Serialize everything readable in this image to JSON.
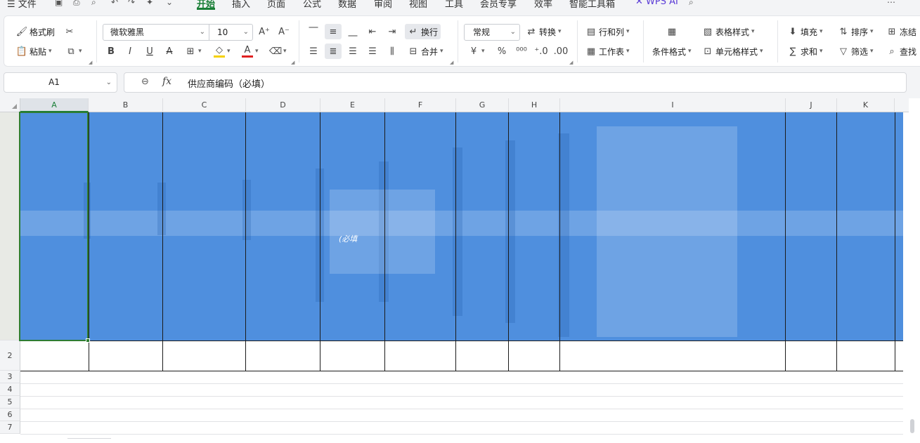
{
  "menu": {
    "file": "文件",
    "tabs": [
      "开始",
      "插入",
      "页面",
      "公式",
      "数据",
      "审阅",
      "视图",
      "工具",
      "会员专享",
      "效率",
      "智能工具箱"
    ],
    "ai": "WPS AI"
  },
  "ribbon": {
    "format_painter": "格式刷",
    "paste": "粘贴",
    "font_name": "微软雅黑",
    "font_size": "10",
    "wrap": "换行",
    "merge": "合并",
    "number_format": "常规",
    "convert": "转换",
    "rows_cols": "行和列",
    "worksheet": "工作表",
    "cond_format": "条件格式",
    "table_style": "表格样式",
    "cell_style": "单元格样式",
    "fill": "填充",
    "sum": "求和",
    "sort": "排序",
    "filter": "筛选",
    "freeze": "冻结",
    "find": "查找",
    "currency_symbol": "¥",
    "percent_symbol": "%"
  },
  "formula": {
    "cell_ref": "A1",
    "fx": "fx",
    "content": "供应商编码（必填）"
  },
  "grid": {
    "columns": [
      "A",
      "B",
      "C",
      "D",
      "E",
      "F",
      "G",
      "H",
      "I",
      "J",
      "K"
    ],
    "rows": [
      "2",
      "3",
      "4",
      "5",
      "6",
      "7"
    ],
    "e1_fragment": "(必填"
  },
  "colors": {
    "accent": "#1a7f37",
    "header_fill": "#4f8fde",
    "selection_border": "#2f7d32"
  }
}
